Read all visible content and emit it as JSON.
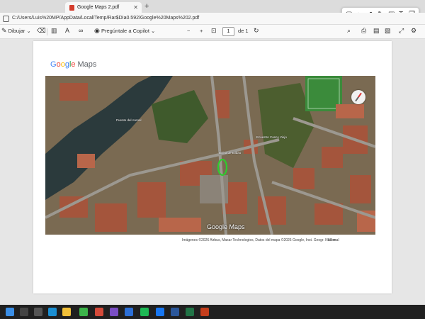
{
  "tabs": [
    {
      "title": "",
      "active": false
    },
    {
      "title": "Google Maps 2.pdf",
      "active": true,
      "close": "✕"
    }
  ],
  "new_tab": "+",
  "address": {
    "url": "C:/Users/Luis%20MP/AppData/Local/Temp/Rar$DIa0.592/Google%20Maps%202.pdf"
  },
  "pdf_toolbar": {
    "draw_label": "Dibujar",
    "copilot_label": "Pregúntale a Copilot",
    "page_current": "1",
    "page_total_label": "de 1",
    "zoom_out": "−",
    "zoom_in": "+"
  },
  "annotation_tools": [
    "square-icon",
    "circle-icon",
    "arrow-icon",
    "pen-icon",
    "highlighter-icon",
    "text-icon",
    "sticky-note-icon"
  ],
  "document": {
    "logo_google": [
      "G",
      "o",
      "o",
      "g",
      "l",
      "e"
    ],
    "logo_maps": "Maps",
    "map_labels": [
      {
        "text": "Puente del Arenal"
      },
      {
        "text": "Bolsa de Bilbao"
      },
      {
        "text": "Ecuestre Casco Viejo"
      }
    ],
    "map_watermark": "Google Maps",
    "attribution": "Imágenes ©2026 Airbus, Maxar Technologies, Datos del mapa ©2026 Google, Inst. Geogr. Nacional",
    "scale": "50 m"
  },
  "colors": {
    "pdf_red": "#d43c2c",
    "route_green": "#2ecc2e"
  },
  "taskbar_icons": [
    "windows-icon",
    "search-icon",
    "task-view-icon",
    "edge-icon",
    "file-explorer-icon",
    "whatsapp-icon",
    "chrome-icon",
    "app-icon",
    "spotify-icon",
    "facebook-icon",
    "word-icon",
    "excel-icon",
    "app2-icon",
    "app3-icon"
  ]
}
